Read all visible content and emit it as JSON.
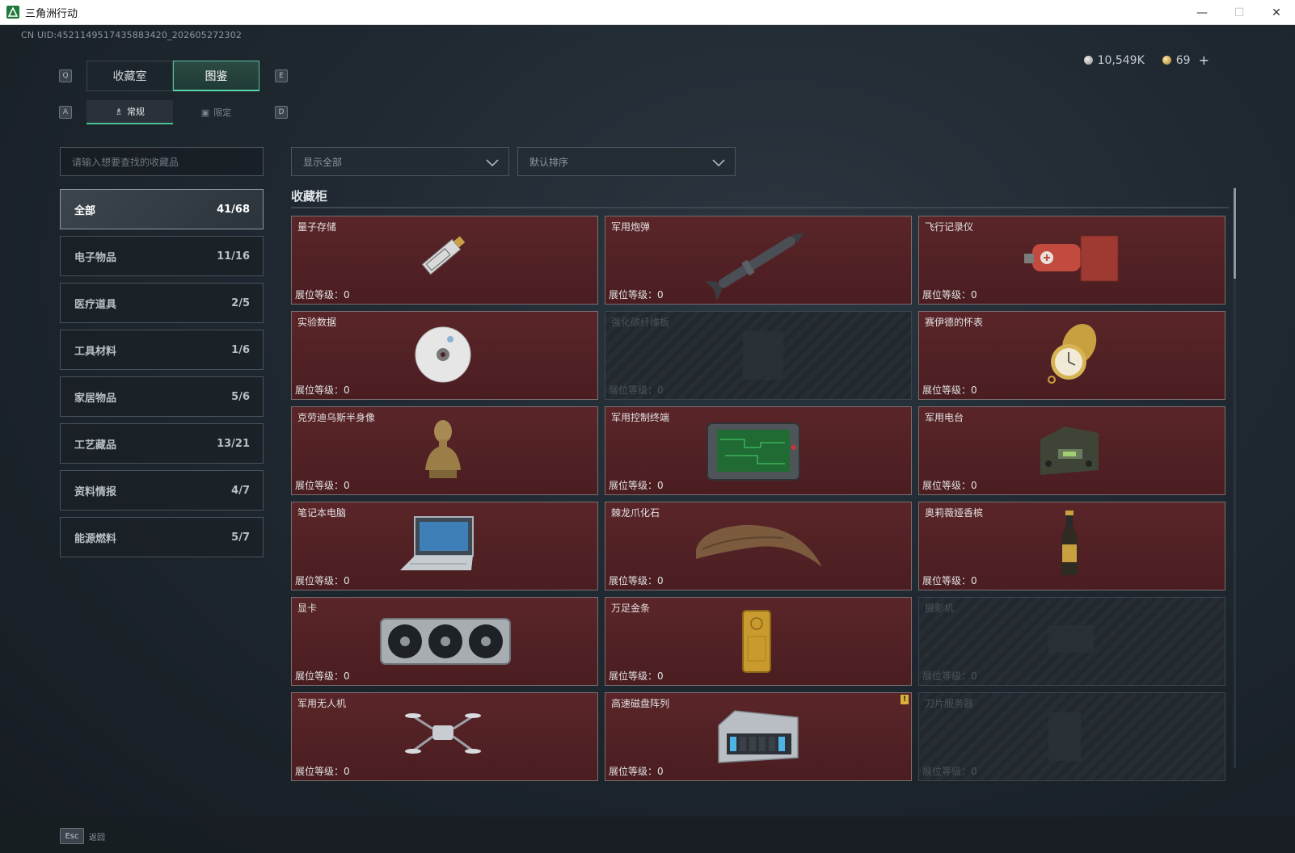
{
  "window": {
    "title": "三角洲行动",
    "min_label": "—",
    "max_label": "☐",
    "close_label": "✕"
  },
  "header": {
    "uid": "CN UID:4521149517435883420_202605272302",
    "silver": "10,549K",
    "gold": "69",
    "plus": "+"
  },
  "keys": {
    "q": "Q",
    "e": "E",
    "a": "A",
    "d": "D",
    "esc": "Esc"
  },
  "tabs": {
    "main": [
      "收藏室",
      "图鉴"
    ],
    "sub": [
      "常规",
      "限定"
    ]
  },
  "search": {
    "placeholder": "请输入想要查找的收藏品"
  },
  "filters": {
    "show": "显示全部",
    "sort": "默认排序"
  },
  "categories": [
    {
      "label": "全部",
      "count": "41/68"
    },
    {
      "label": "电子物品",
      "count": "11/16"
    },
    {
      "label": "医疗道具",
      "count": "2/5"
    },
    {
      "label": "工具材料",
      "count": "1/6"
    },
    {
      "label": "家居物品",
      "count": "5/6"
    },
    {
      "label": "工艺藏品",
      "count": "13/21"
    },
    {
      "label": "资料情报",
      "count": "4/7"
    },
    {
      "label": "能源燃料",
      "count": "5/7"
    }
  ],
  "section": {
    "title": "收藏柜"
  },
  "level_label": "展位等级：0",
  "items": [
    {
      "name": "量子存储",
      "level": "展位等级：0",
      "unlocked": true,
      "icon": "usb-icon"
    },
    {
      "name": "军用炮弹",
      "level": "展位等级：0",
      "unlocked": true,
      "icon": "missile-icon"
    },
    {
      "name": "飞行记录仪",
      "level": "展位等级：0",
      "unlocked": true,
      "icon": "flight-recorder-icon"
    },
    {
      "name": "实验数据",
      "level": "展位等级：0",
      "unlocked": true,
      "icon": "disc-icon"
    },
    {
      "name": "强化碳纤维板",
      "level": "展位等级：0",
      "unlocked": false,
      "icon": "carbon-plate-icon"
    },
    {
      "name": "赛伊德的怀表",
      "level": "展位等级：0",
      "unlocked": true,
      "icon": "pocket-watch-icon"
    },
    {
      "name": "克劳迪乌斯半身像",
      "level": "展位等级：0",
      "unlocked": true,
      "icon": "bust-icon"
    },
    {
      "name": "军用控制终端",
      "level": "展位等级：0",
      "unlocked": true,
      "icon": "terminal-icon"
    },
    {
      "name": "军用电台",
      "level": "展位等级：0",
      "unlocked": true,
      "icon": "radio-icon"
    },
    {
      "name": "笔记本电脑",
      "level": "展位等级：0",
      "unlocked": true,
      "icon": "laptop-icon"
    },
    {
      "name": "棘龙爪化石",
      "level": "展位等级：0",
      "unlocked": true,
      "icon": "claw-fossil-icon"
    },
    {
      "name": "奥莉薇娅香槟",
      "level": "展位等级：0",
      "unlocked": true,
      "icon": "champagne-icon"
    },
    {
      "name": "显卡",
      "level": "展位等级：0",
      "unlocked": true,
      "icon": "gpu-icon"
    },
    {
      "name": "万足金条",
      "level": "展位等级：0",
      "unlocked": true,
      "icon": "gold-bar-icon"
    },
    {
      "name": "摄影机",
      "level": "展位等级：0",
      "unlocked": false,
      "icon": "camera-icon"
    },
    {
      "name": "军用无人机",
      "level": "展位等级：0",
      "unlocked": true,
      "icon": "drone-icon"
    },
    {
      "name": "高速磁盘阵列",
      "level": "展位等级：0",
      "unlocked": true,
      "icon": "disk-array-icon",
      "badge": "!"
    },
    {
      "name": "刀片服务器",
      "level": "展位等级：0",
      "unlocked": false,
      "icon": "blade-server-icon"
    }
  ],
  "footer": {
    "back": "返回"
  },
  "colors": {
    "accent": "#57d7a6",
    "card_bg": "#4e1f23",
    "locked_bg": "#22282e",
    "badge": "#d9b13a"
  }
}
